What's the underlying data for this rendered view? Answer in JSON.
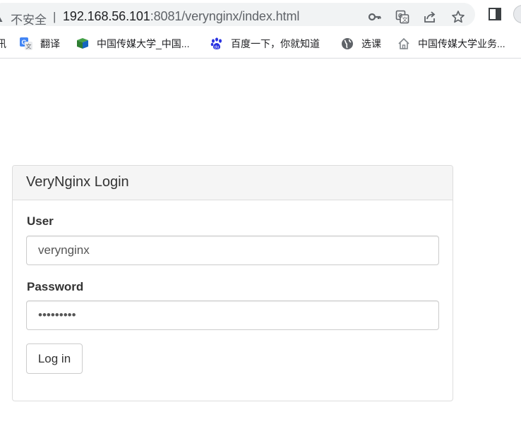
{
  "browser": {
    "security_label": "不安全",
    "separator": "|",
    "url_host": "192.168.56.101",
    "url_rest": ":8081/verynginx/index.html",
    "icons": [
      "warning-icon",
      "key-icon",
      "translate-icon",
      "share-icon",
      "star-icon",
      "sidepanel-icon",
      "profile-avatar-icon"
    ]
  },
  "bookmarks": [
    {
      "label": "讯",
      "icon": "bookmark-partial"
    },
    {
      "label": "翻译",
      "icon": "google-translate-icon"
    },
    {
      "label": "中国传媒大学_中国...",
      "icon": "cuc-library-icon"
    },
    {
      "label": "百度一下，你就知道",
      "icon": "baidu-paw-icon"
    },
    {
      "label": "选课",
      "icon": "globe-icon"
    },
    {
      "label": "中国传媒大学业务...",
      "icon": "home-icon"
    }
  ],
  "login": {
    "title": "VeryNginx Login",
    "user_label": "User",
    "user_value": "verynginx",
    "password_label": "Password",
    "password_value": "verynginx",
    "submit_label": "Log in"
  }
}
